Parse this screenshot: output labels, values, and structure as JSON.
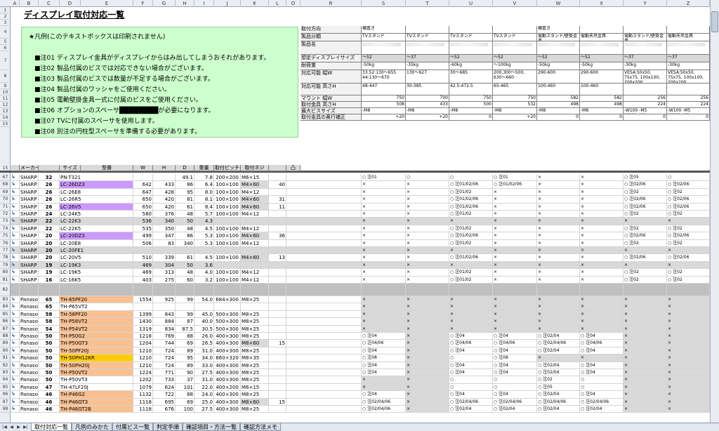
{
  "sheet": {
    "title": "ディスプレイ取付対応一覧",
    "columns": [
      "A",
      "B",
      "C",
      "D",
      "E",
      "F",
      "G",
      "H",
      "I",
      "J",
      "K",
      "L",
      "O",
      "R",
      "S",
      "T",
      "U",
      "V",
      "W",
      "X",
      "Y",
      "Z"
    ],
    "notes": {
      "title": "★凡例(このテキストボックスは印刷されません)",
      "lines": [
        "■注01 ディスプレイ金具がディスプレイからはみ出してしまうおそれがあります。",
        "■注02 製品付属のビスでは対応できない場合がございます。",
        "■注03 製品付属のビスでは数量が不足する場合がございます。",
        "■注04 製品付属のワッシャをご使用ください。",
        "■注05 電動壁掛金具一式に付属のビスをご使用ください。",
        "■注06 オプションのスペーサ████████が必要になります。",
        "■注07 TVに付属のスペーサを使用します。",
        "■注08 別注の円柱型スペーサを準備する必要があります。"
      ]
    },
    "spec_labels": [
      "取付方向",
      "製品分類",
      "製品名",
      "想定ディスプレイサイズ",
      "耐荷重",
      "対応可能 幅W",
      "対応可能 高さH",
      "マウント 幅W",
      "取付金具 高さH",
      "最大ビスサイズ",
      "取付金具の奥行補正"
    ],
    "spec_cols": [
      {
        "dir": "横置き",
        "cat": "TVスタンド",
        "size": "～52",
        "load": "-50kg",
        "w": "33.52:130～655\n44:130～670",
        "h": "48-447",
        "mw": "750",
        "mh": "508",
        "screw": "-M8",
        "adj": "+20"
      },
      {
        "dir": "",
        "cat": "TVスタンド",
        "size": "～37",
        "load": "-35kg",
        "w": "130～627",
        "h": "30-385",
        "mw": "700",
        "mh": "433",
        "screw": "-M8",
        "adj": "+20"
      },
      {
        "dir": "",
        "cat": "TVスタンド",
        "size": "～52",
        "load": "-60kg",
        "w": "30～685",
        "h": "42.5-472.5",
        "mw": "750",
        "mh": "500",
        "screw": "-M8",
        "adj": "0"
      },
      {
        "dir": "",
        "cat": "TVスタンド",
        "size": "～52",
        "load": "～100kg",
        "w": "200,300～500,\n630～660",
        "h": "65-465",
        "mw": "750",
        "mh": "532",
        "screw": "-M8",
        "adj": "+20"
      },
      {
        "dir": "横置き",
        "cat": "電動スタンド/壁掛金具",
        "size": "～52",
        "load": "-50kg",
        "w": "290-600",
        "h": "100-460",
        "mw": "582",
        "mh": "498",
        "screw": "-M8",
        "adj": "0"
      },
      {
        "dir": "",
        "cat": "電動天吊金具",
        "size": "～52",
        "load": "-50kg",
        "w": "290-600",
        "h": "100-460",
        "mw": "582",
        "mh": "498",
        "screw": "-M8",
        "adj": "0"
      },
      {
        "dir": "",
        "cat": "電動スタンド/壁掛金具",
        "size": "～37",
        "load": "-30kg",
        "w": "VESA:50x50,\n75x75, 100x100,\n200x200,\n200x100,\n200x150",
        "h": "",
        "mw": "256",
        "mh": "224",
        "screw": "-W100 -M5\nW200 -M6",
        "adj": "0"
      },
      {
        "dir": "",
        "cat": "電動天吊金具",
        "size": "～37",
        "load": "-30kg",
        "w": "VESA:50x50,\n75x75, 100x100,\n200x200,\n200x100,\n200x150",
        "h": "",
        "mw": "256",
        "mh": "224",
        "screw": "-W100 -M5\nW200 -M6",
        "adj": "0"
      }
    ],
    "table_headers": [
      "メーカー",
      "サイズ",
      "型番",
      "W",
      "H",
      "D",
      "重量",
      "取付ピッチ",
      "取付ネジ",
      "凸"
    ],
    "rows": [
      {
        "n": "67",
        "maker": "SHARP",
        "size": "32",
        "model": "PN-T321",
        "w": "",
        "h": "",
        "d": "49.1",
        "wt": "7.8",
        "pitch": "200×200",
        "screw": "M6×15",
        "o": "",
        "hl": "",
        "marks": [
          "○ 注01",
          "○",
          "○",
          "○ 注01",
          "×",
          "×",
          "○ 注05",
          "○"
        ]
      },
      {
        "n": "68",
        "maker": "SHARP",
        "size": "26",
        "model": "LC-26DZ3",
        "w": "642",
        "h": "433",
        "d": "86",
        "wt": "6.4",
        "pitch": "100×100",
        "screw": "M4×60",
        "o": "40",
        "hl": "purple",
        "marks": [
          "×",
          "×",
          "○ 注01/02/06",
          "○ 注01/02/06",
          "×",
          "×",
          "○ 注02/06",
          "○ 注02/06"
        ]
      },
      {
        "n": "69",
        "maker": "SHARP",
        "size": "26",
        "model": "LC-26E8",
        "w": "647",
        "h": "428",
        "d": "95",
        "wt": "8.0",
        "pitch": "100×100",
        "screw": "M4×12",
        "o": "",
        "hl": "",
        "marks": [
          "×",
          "×",
          "○ 注01/02",
          "×",
          "×",
          "×",
          "○ 注02",
          "○ 注02"
        ]
      },
      {
        "n": "70",
        "maker": "SHARP",
        "size": "26",
        "model": "LC-26R5",
        "w": "650",
        "h": "420",
        "d": "81",
        "wt": "8.1",
        "pitch": "100×100",
        "screw": "M4×60",
        "o": "31",
        "hl": "",
        "marks": [
          "×",
          "×",
          "○ 注01/02/06",
          "×",
          "×",
          "×",
          "○ 注02/06",
          "○ 注02/06"
        ]
      },
      {
        "n": "71",
        "maker": "SHARP",
        "size": "26",
        "model": "LC-26V5",
        "w": "650",
        "h": "420",
        "d": "61",
        "wt": "8.4",
        "pitch": "100×100",
        "screw": "M4×60",
        "o": "11",
        "hl": "purple",
        "marks": [
          "×",
          "×",
          "○ 注01/02/06",
          "×",
          "×",
          "×",
          "○ 注02/06",
          "○ 注02/06"
        ]
      },
      {
        "n": "72",
        "maker": "SHARP",
        "size": "24",
        "model": "LC-24K5",
        "w": "580",
        "h": "376",
        "d": "48",
        "wt": "5.7",
        "pitch": "100×100",
        "screw": "M4×12",
        "o": "",
        "hl": "",
        "marks": [
          "×",
          "×",
          "○ 注01/02",
          "×",
          "×",
          "×",
          "○ 注02",
          "○ 注02"
        ]
      },
      {
        "n": "73",
        "maker": "SHARP",
        "size": "22",
        "model": "LC-22K3",
        "w": "536",
        "h": "340",
        "d": "50",
        "wt": "4.3",
        "pitch": "",
        "screw": "",
        "o": "",
        "hl": "gray",
        "marks": [
          "×",
          "×",
          "×",
          "×",
          "×",
          "×",
          "×",
          "×"
        ]
      },
      {
        "n": "74",
        "maker": "SHARP",
        "size": "22",
        "model": "LC-22K5",
        "w": "535",
        "h": "350",
        "d": "48",
        "wt": "4.5",
        "pitch": "100×100",
        "screw": "M4×12",
        "o": "",
        "hl": "",
        "marks": [
          "×",
          "×",
          "○ 注01/02",
          "×",
          "×",
          "×",
          "○ 注02",
          "○ 注02"
        ]
      },
      {
        "n": "75",
        "maker": "SHARP",
        "size": "20",
        "model": "LC-20DZ3",
        "w": "499",
        "h": "347",
        "d": "86",
        "wt": "5.3",
        "pitch": "100×100",
        "screw": "M4×60",
        "o": "36",
        "hl": "purple",
        "marks": [
          "×",
          "×",
          "○ 注01/02/06",
          "×",
          "×",
          "×",
          "○ 注02/06",
          "○ 注02/06"
        ]
      },
      {
        "n": "76",
        "maker": "SHARP",
        "size": "20",
        "model": "LC-20E8",
        "w": "506",
        "h": "83",
        "d": "340",
        "wt": "5.3",
        "pitch": "100×100",
        "screw": "M4×12",
        "o": "",
        "hl": "",
        "marks": [
          "×",
          "×",
          "○ 注01/02",
          "×",
          "×",
          "×",
          "○ 注02",
          "○ 注02"
        ]
      },
      {
        "n": "77",
        "maker": "SHARP",
        "size": "20",
        "model": "LC-20FE1",
        "w": "",
        "h": "",
        "d": "",
        "wt": "",
        "pitch": "",
        "screw": "",
        "o": "",
        "hl": "gray",
        "marks": [
          "×",
          "×",
          "×",
          "×",
          "×",
          "×",
          "×",
          "×"
        ]
      },
      {
        "n": "78",
        "maker": "SHARP",
        "size": "20",
        "model": "LC-20V5",
        "w": "510",
        "h": "339",
        "d": "61",
        "wt": "4.5",
        "pitch": "100×100",
        "screw": "M4×60",
        "o": "13",
        "hl": "",
        "marks": [
          "×",
          "×",
          "○ 注01/02/06",
          "×",
          "×",
          "×",
          "○ 注02/06",
          "○ 注02/06"
        ]
      },
      {
        "n": "79",
        "maker": "SHARP",
        "size": "19",
        "model": "LC-19K3",
        "w": "469",
        "h": "304",
        "d": "50",
        "wt": "3.6",
        "pitch": "",
        "screw": "",
        "o": "",
        "hl": "gray",
        "marks": [
          "×",
          "×",
          "×",
          "×",
          "×",
          "×",
          "×",
          "×"
        ]
      },
      {
        "n": "80",
        "maker": "SHARP",
        "size": "19",
        "model": "LC-19K5",
        "w": "469",
        "h": "313",
        "d": "48",
        "wt": "4.0",
        "pitch": "100×100",
        "screw": "M4×12",
        "o": "",
        "hl": "",
        "marks": [
          "×",
          "×",
          "○ 注01/02",
          "×",
          "×",
          "×",
          "○ 注02",
          "○ 注02"
        ]
      },
      {
        "n": "81",
        "maker": "SHARP",
        "size": "16",
        "model": "LC-16K5",
        "w": "403",
        "h": "275",
        "d": "60",
        "wt": "3.2",
        "pitch": "100×100",
        "screw": "M4×12",
        "o": "",
        "hl": "",
        "marks": [
          "×",
          "×",
          "○ 注01/02",
          "×",
          "×",
          "×",
          "○ 注02",
          "○ 注02"
        ]
      },
      {
        "n": "82",
        "maker": "",
        "size": "",
        "model": "",
        "w": "",
        "h": "",
        "d": "",
        "wt": "",
        "pitch": "",
        "screw": "",
        "o": "",
        "hl": "sep",
        "marks": [
          "",
          "",
          "",
          "",
          "",
          "",
          "",
          ""
        ]
      },
      {
        "n": "83",
        "maker": "Panasonic",
        "size": "65",
        "model": "TH-65PF20",
        "w": "1554",
        "h": "925",
        "d": "99",
        "wt": "54.0",
        "pitch": "684×300",
        "screw": "M8×25",
        "o": "",
        "hl": "orange",
        "marks": [
          "×",
          "×",
          "×",
          "×",
          "×",
          "×",
          "×",
          "×"
        ]
      },
      {
        "n": "84",
        "maker": "Panasonic",
        "size": "65",
        "model": "TH-P65VT2",
        "w": "",
        "h": "",
        "d": "",
        "wt": "",
        "pitch": "",
        "screw": "",
        "o": "",
        "hl": "",
        "marks": [
          "×",
          "×",
          "×",
          "×",
          "×",
          "×",
          "×",
          "×"
        ]
      },
      {
        "n": "85",
        "maker": "Panasonic",
        "size": "58",
        "model": "TH-58PF20",
        "w": "1399",
        "h": "843",
        "d": "99",
        "wt": "45.0",
        "pitch": "500×300",
        "screw": "M8×25",
        "o": "",
        "hl": "orange",
        "marks": [
          "×",
          "×",
          "×",
          "×",
          "×",
          "×",
          "×",
          "×"
        ]
      },
      {
        "n": "86",
        "maker": "Panasonic",
        "size": "58",
        "model": "TH-P58VT2",
        "w": "1430",
        "h": "884",
        "d": "87",
        "wt": "40.0",
        "pitch": "500×300",
        "screw": "M8×25",
        "o": "",
        "hl": "orange",
        "marks": [
          "×",
          "×",
          "×",
          "×",
          "×",
          "×",
          "×",
          "×"
        ]
      },
      {
        "n": "87",
        "maker": "Panasonic",
        "size": "54",
        "model": "TH-P54VT2",
        "w": "1319",
        "h": "834",
        "d": "87.5",
        "wt": "30.5",
        "pitch": "500×300",
        "screw": "M8×25",
        "o": "",
        "hl": "orange",
        "marks": [
          "×",
          "×",
          "×",
          "×",
          "×",
          "×",
          "×",
          "×"
        ]
      },
      {
        "n": "88",
        "maker": "Panasonic",
        "size": "50",
        "model": "TH-P50G2",
        "w": "1218",
        "h": "769",
        "d": "88",
        "wt": "26.0",
        "pitch": "400×300",
        "screw": "M8×25",
        "o": "",
        "hl": "orange",
        "marks": [
          "○ 注04",
          "×",
          "○ 注04",
          "○ 注04",
          "○ 注02/04",
          "○ 注04",
          "×",
          "×"
        ]
      },
      {
        "n": "89",
        "maker": "Panasonic",
        "size": "50",
        "model": "TH-P50GT3",
        "w": "1204",
        "h": "744",
        "d": "69",
        "wt": "26.5",
        "pitch": "400×300",
        "screw": "M8×60",
        "o": "15",
        "hl": "orange",
        "marks": [
          "○ 注04/06",
          "×",
          "○ 注04/06",
          "○ 注04/06",
          "○ 注02/04/06",
          "○ 注04/06",
          "×",
          "×"
        ]
      },
      {
        "n": "90",
        "maker": "Panasonic",
        "size": "50",
        "model": "TH-50PF20J",
        "w": "1210",
        "h": "724",
        "d": "89",
        "wt": "31.0",
        "pitch": "400×300",
        "screw": "M8×25",
        "o": "",
        "hl": "orange",
        "marks": [
          "○ 注04",
          "×",
          "○ 注04",
          "○ 注04",
          "○ 注02/04",
          "○ 注04",
          "×",
          "×"
        ]
      },
      {
        "n": "91",
        "maker": "Panasonic",
        "size": "50",
        "model": "TH-50PH12KR",
        "w": "1210",
        "h": "724",
        "d": "95",
        "wt": "34.0",
        "pitch": "660×320",
        "screw": "M8×35",
        "o": "",
        "hl": "yellow",
        "marks": [
          "○ 注08",
          "×",
          "○",
          "○ 注08",
          "×",
          "×",
          "×",
          "×"
        ]
      },
      {
        "n": "92",
        "maker": "Panasonic",
        "size": "50",
        "model": "TH-50PH20J",
        "w": "1210",
        "h": "724",
        "d": "89",
        "wt": "33.0",
        "pitch": "400×300",
        "screw": "M8×25",
        "o": "",
        "hl": "orange",
        "marks": [
          "○ 注04",
          "×",
          "○ 注04",
          "○ 注04",
          "○ 注02/04",
          "○ 注04",
          "×",
          "×"
        ]
      },
      {
        "n": "93",
        "maker": "Panasonic",
        "size": "50",
        "model": "TH-P50VT2",
        "w": "1224",
        "h": "771",
        "d": "90",
        "wt": "27.5",
        "pitch": "400×300",
        "screw": "M8×25",
        "o": "",
        "hl": "orange",
        "marks": [
          "○ 注04",
          "×",
          "○ 注04",
          "○ 注04",
          "○ 注02/04",
          "○ 注04",
          "×",
          "×"
        ]
      },
      {
        "n": "94",
        "maker": "Panasonic",
        "size": "50",
        "model": "TH-P50VT3",
        "w": "1202",
        "h": "733",
        "d": "37",
        "wt": "31.0",
        "pitch": "400×300",
        "screw": "M8×25",
        "o": "",
        "hl": "",
        "marks": [
          "×",
          "×",
          "○",
          "○",
          "○ 注02",
          "○",
          "×",
          "×"
        ]
      },
      {
        "n": "95",
        "maker": "Panasonic",
        "size": "47",
        "model": "TH-47LF20J",
        "w": "1079",
        "h": "624",
        "d": "101",
        "wt": "22.0",
        "pitch": "400×200",
        "screw": "M6×15",
        "o": "",
        "hl": "",
        "marks": [
          "×",
          "×",
          "○",
          "○",
          "○ 注05",
          "○",
          "×",
          "×"
        ]
      },
      {
        "n": "96",
        "maker": "Panasonic",
        "size": "46",
        "model": "TH-P46G2",
        "w": "1132",
        "h": "722",
        "d": "88",
        "wt": "24.0",
        "pitch": "400×300",
        "screw": "M8×25",
        "o": "",
        "hl": "orange",
        "marks": [
          "○ 注04",
          "×",
          "○ 注04",
          "○ 注04",
          "○ 注02/04",
          "○ 注04",
          "×",
          "×"
        ]
      },
      {
        "n": "97",
        "maker": "Panasonic",
        "size": "46",
        "model": "TH-P46GT3",
        "w": "1118",
        "h": "695",
        "d": "69",
        "wt": "25.0",
        "pitch": "400×300",
        "screw": "M8×60",
        "o": "15",
        "hl": "orange",
        "marks": [
          "○ 注02/04/06",
          "×",
          "○ 注02/04/06",
          "○ 注02/04/06",
          "○ 注02/04/06",
          "○ 注02/04/06",
          "×",
          "×"
        ]
      },
      {
        "n": "98",
        "maker": "Panasonic",
        "size": "46",
        "model": "TH-P46GT2B",
        "w": "1118",
        "h": "676",
        "d": "100",
        "wt": "27.5",
        "pitch": "400×300",
        "screw": "M8×25",
        "o": "",
        "hl": "orange",
        "marks": [
          "○ 注02/04/06",
          "×",
          "○ 注02/04",
          "○ 注02/04",
          "○ 注02/04",
          "○ 注02/04",
          "×",
          "×"
        ]
      }
    ],
    "tabs": [
      "取付対応一覧",
      "凡例のみかた",
      "付属ビス一覧",
      "判定手順",
      "確認項目・方法一覧",
      "確認方法メモ"
    ],
    "active_tab": 0
  }
}
